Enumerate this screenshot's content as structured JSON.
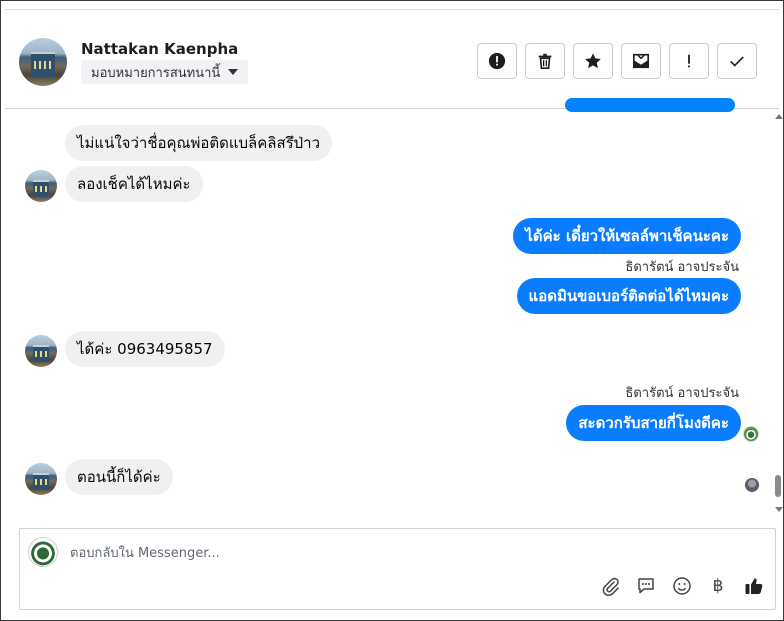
{
  "header": {
    "contact_name": "Nattakan Kaenpha",
    "assign_label": "มอบหมายการสนทนานี้",
    "toolbar": [
      {
        "icon": "alert-circle-icon",
        "label": "Mark as spam"
      },
      {
        "icon": "trash-icon",
        "label": "Delete"
      },
      {
        "icon": "star-icon",
        "label": "Star"
      },
      {
        "icon": "mark-unread-icon",
        "label": "Mark as unread"
      },
      {
        "icon": "exclamation-icon",
        "label": "Follow up"
      },
      {
        "icon": "check-icon",
        "label": "Mark as done"
      }
    ]
  },
  "messages": [
    {
      "direction": "in",
      "text": "ไม่แน่ใจว่าชื่อคุณพ่อติดแบล็คลิสรึป่าว",
      "avatar": false
    },
    {
      "direction": "in",
      "text": "ลองเช็คได้ไหมค่ะ",
      "avatar": true
    },
    {
      "direction": "out",
      "text": "ได้ค่ะ เดี๋ยวให้เซลล์พาเช็คนะคะ"
    },
    {
      "direction": "out",
      "sender": "ธิดารัตน์ อาจประจัน",
      "text": "แอดมินขอเบอร์ติดต่อได้ไหมคะ"
    },
    {
      "direction": "in",
      "text": "ได้ค่ะ 0963495857",
      "avatar": true
    },
    {
      "direction": "out",
      "sender": "ธิดารัตน์ อาจประจัน",
      "text": "สะดวกรับสายกี่โมงดีคะ"
    },
    {
      "direction": "in",
      "text": "ตอนนี้ก็ได้ค่ะ",
      "avatar": true
    }
  ],
  "composer": {
    "placeholder": "ตอบกลับใน Messenger...",
    "tools": [
      "attachment-icon",
      "saved-replies-icon",
      "emoji-icon",
      "baht-icon",
      "like-icon"
    ],
    "currency_symbol": "฿"
  },
  "colors": {
    "outgoing_bubble": "#0a7cff",
    "incoming_bubble": "#f0f0f0",
    "border": "#cfd2d6"
  }
}
